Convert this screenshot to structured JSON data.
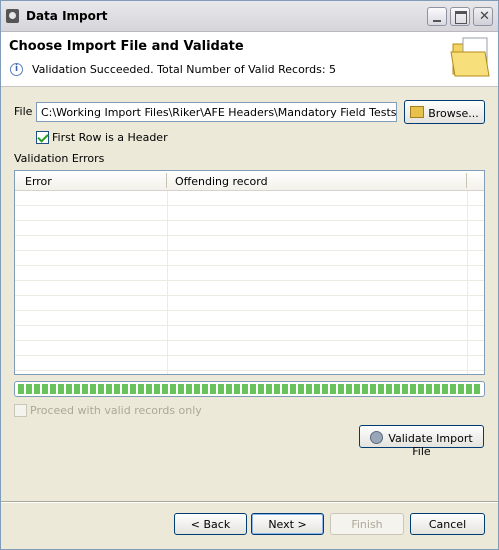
{
  "window": {
    "title": "Data Import"
  },
  "header": {
    "title": "Choose Import File and Validate",
    "message": "Validation Succeeded. Total Number of Valid Records: 5",
    "info_icon": "info-icon",
    "art_icon": "folder-document-icon"
  },
  "file": {
    "label": "File",
    "path": "C:\\Working Import Files\\Riker\\AFE Headers\\Mandatory Field Tests\\Check",
    "browse_label": "Browse..."
  },
  "first_row_header": {
    "label": "First Row is a Header",
    "checked": true
  },
  "validation_errors": {
    "label": "Validation Errors",
    "columns": [
      "Error",
      "Offending record"
    ],
    "rows": []
  },
  "progress": {
    "percent": 100
  },
  "proceed": {
    "label": "Proceed with valid records only",
    "checked": false,
    "enabled": false
  },
  "buttons": {
    "validate": "Validate Import File",
    "back": "< Back",
    "next": "Next >",
    "finish": "Finish",
    "cancel": "Cancel"
  },
  "colors": {
    "accent": "#003c74",
    "progress": "#68c45a",
    "info": "#3b63b2"
  }
}
